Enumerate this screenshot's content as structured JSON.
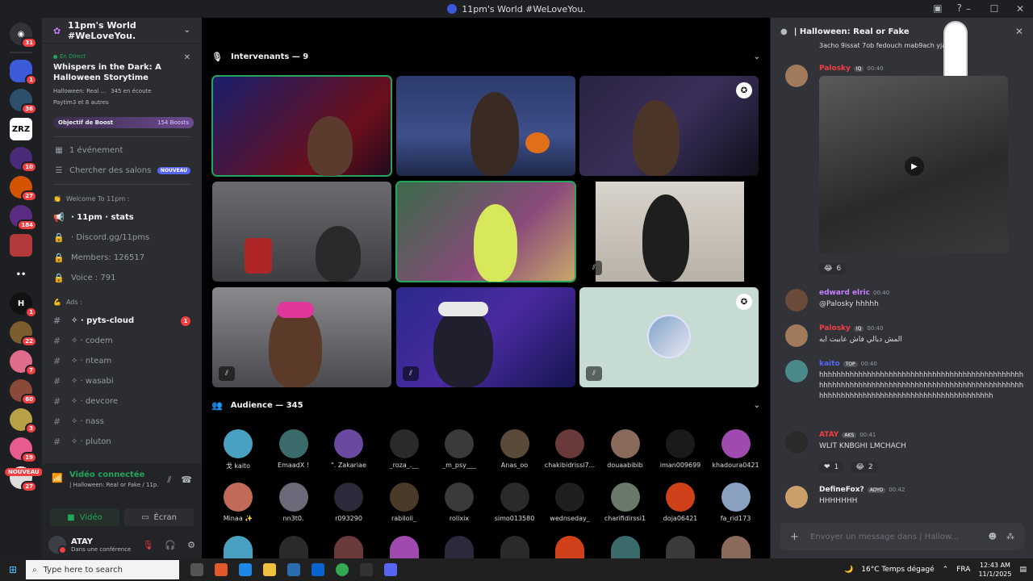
{
  "window": {
    "title": "11pm's World #WeLoveYou."
  },
  "rail": {
    "badges": [
      "31",
      "1",
      "36",
      "",
      "10",
      "27",
      "184",
      "",
      "",
      "1",
      "22",
      "7",
      "60",
      "3",
      "19",
      "27"
    ],
    "zrz_label": "ZRZ",
    "nouveau_label": "NOUVEAU"
  },
  "sidebar": {
    "guild_name": "11pm's World #WeLoveYou.",
    "live": {
      "tag": "En Direct",
      "title": "Whispers in the Dark: A Halloween Storytime",
      "channel": "Halloween: Real ...",
      "listeners": "345 en écoute",
      "users": "Paytim3 et 8 autres"
    },
    "boost": {
      "label": "Objectif de Boost",
      "count": "154 Boosts"
    },
    "events_label": "1 événement",
    "browse_label": "Chercher des salons",
    "browse_badge": "NOUVEAU",
    "cat1": "Welcome To 11pm :",
    "channels_a": [
      {
        "name": "· 11pm · stats",
        "bold": true
      },
      {
        "name": "· Discord.gg/11pms"
      },
      {
        "name": "Members: 126517"
      },
      {
        "name": "Voice : 791"
      }
    ],
    "cat2": "Ads :",
    "channels_b": [
      {
        "name": "✧ · pyts-cloud",
        "badge": "1"
      },
      {
        "name": "✧ · codem"
      },
      {
        "name": "✧ · nteam"
      },
      {
        "name": "✧ · wasabi"
      },
      {
        "name": "✧ · devcore"
      },
      {
        "name": "✧ · nass"
      },
      {
        "name": "✧ · pluton"
      }
    ],
    "voice": {
      "status": "Vidéo connectée",
      "channel": "| Halloween: Real or Fake / 11p...",
      "video_btn": "Vidéo",
      "screen_btn": "Écran"
    },
    "user": {
      "name": "ATAY",
      "status": "Dans une conférence"
    }
  },
  "stage": {
    "speakers_label": "Intervenants — 9",
    "audience_label": "Audience — 345",
    "audience": [
      "戈 kaito",
      "EmaadX !",
      "\". Zakariae",
      "_roza_.__",
      "_m_psy___",
      "Anas_oo",
      "chakibidrissi7...",
      "douaabibib",
      "iman009699",
      "khadoura0421",
      "Minaa ✨",
      "nn3t0.",
      "r093290",
      "rabiloli_",
      "rolixix",
      "simo013580",
      "wednseday_",
      "charifidirssi1",
      "doja06421",
      "fa_rid173"
    ]
  },
  "chat": {
    "title": "| Halloween: Real or Fake",
    "partial_top": "3acho 9issat 7ob fedouch mab9ach yjada",
    "messages": [
      {
        "name": "Palosky",
        "tags": [
          "IQ"
        ],
        "time": "00:40",
        "body": "",
        "react_count": "6",
        "color": "#f23f42"
      },
      {
        "name": "edward elric",
        "tags": [],
        "time": "00:40",
        "body": "@Palosky hhhhh",
        "color": "#c77dff"
      },
      {
        "name": "Palosky",
        "tags": [
          "IQ"
        ],
        "time": "00:40",
        "body": "المش ديالي فاش عايبت ايه",
        "color": "#f23f42"
      },
      {
        "name": "kaito",
        "tags": [
          "TOP"
        ],
        "time": "00:40",
        "body": "hhhhhhhhhhhhhhhhhhhhhhhhhhhhhhhhhhhhhhhhhhhhhhhhhhhhhhhhhhhhhhhhhhhhhhhhhhhhhhhhhhhhhhhhhhhhhhhhhhhhhhhhhhhhhhhhhhhhhhhhhhhhhhhhhhhhhh",
        "color": "#5865f2"
      },
      {
        "name": "ATAY",
        "tags": [
          "AKS"
        ],
        "time": "00:41",
        "body": "WLIT KNBGHI LMCHACH",
        "react1": "1",
        "react2": "2",
        "color": "#f23f42"
      },
      {
        "name": "DefineFox?",
        "tags": [
          "ADYO"
        ],
        "time": "00:42",
        "body": "HHHHHHH",
        "color": "#f2f3f5"
      }
    ],
    "input_placeholder": "Envoyer un message dans | Hallow..."
  },
  "taskbar": {
    "search": "Type here to search",
    "weather": "16°C  Temps dégagé",
    "lang": "FRA",
    "time": "12:43 AM",
    "date": "11/1/2025"
  }
}
